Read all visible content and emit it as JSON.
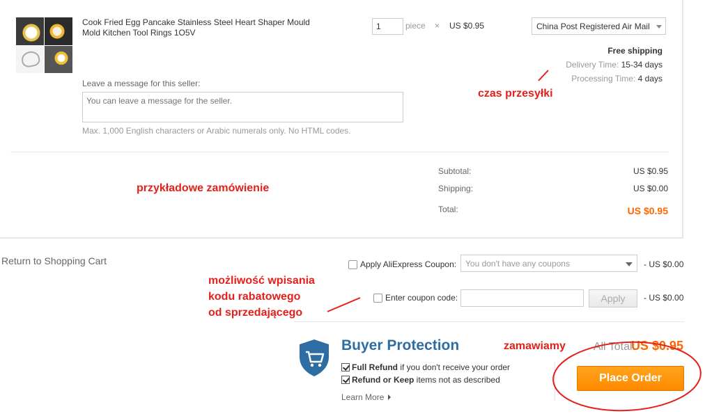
{
  "item": {
    "title": "Cook Fried Egg Pancake Stainless Steel Heart Shaper Mould Mold Kitchen Tool Rings 1O5V",
    "quantity": "1",
    "quantity_unit": "piece",
    "times": "×",
    "unit_price": "US $0.95",
    "shipping_method": "China Post Registered Air Mail",
    "free_shipping": "Free shipping",
    "delivery_label": "Delivery Time:",
    "delivery_value": "15-34 days",
    "processing_label": "Processing Time:",
    "processing_value": "4 days"
  },
  "message": {
    "label": "Leave a message for this seller:",
    "placeholder": "You can leave a message for the seller.",
    "hint": "Max. 1,000 English characters or Arabic numerals only. No HTML codes."
  },
  "summary": {
    "subtotal_label": "Subtotal:",
    "subtotal_value": "US $0.95",
    "shipping_label": "Shipping:",
    "shipping_value": "US $0.00",
    "total_label": "Total:",
    "total_value": "US $0.95"
  },
  "annotations": {
    "delivery_note": "czas przesyłki",
    "sample_order": "przykładowe zamówienie",
    "coupon_note_1": "możliwość wpisania",
    "coupon_note_2": "kodu rabatowego",
    "coupon_note_3": "od sprzedającego",
    "order_note": "zamawiamy"
  },
  "return_link": "Return to Shopping Cart",
  "coupons": {
    "aliexpress_label": "Apply AliExpress Coupon:",
    "aliexpress_selected": "You don't have any coupons",
    "aliexpress_value": "- US $0.00",
    "code_label": "Enter coupon code:",
    "apply_label": "Apply",
    "code_value": "- US $0.00"
  },
  "protection": {
    "title": "Buyer Protection",
    "line1_bold": "Full Refund",
    "line1_rest": " if you don't receive your order",
    "line2_bold": "Refund or Keep",
    "line2_rest": " items not as described",
    "learn_more": "Learn More"
  },
  "checkout": {
    "all_total_label": "All Total:",
    "all_total_value": "US $0.95",
    "place_order": "Place Order"
  },
  "colors": {
    "accent_orange": "#ff8a00",
    "total_orange": "#ff6600",
    "annotation_red": "#e4201a",
    "protection_blue": "#2e6da4"
  }
}
